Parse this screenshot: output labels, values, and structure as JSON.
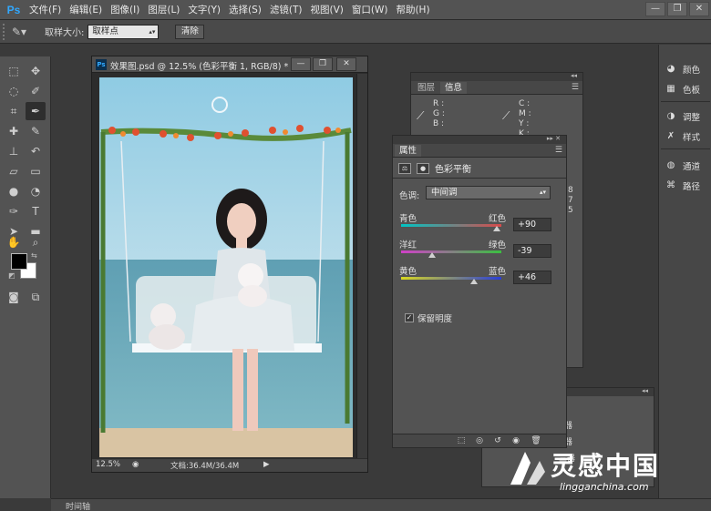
{
  "app": {
    "logo": "Ps"
  },
  "menu": [
    "文件(F)",
    "编辑(E)",
    "图像(I)",
    "图层(L)",
    "文字(Y)",
    "选择(S)",
    "滤镜(T)",
    "视图(V)",
    "窗口(W)",
    "帮助(H)"
  ],
  "window_controls": {
    "minimize": "—",
    "restore": "❐",
    "close": "✕"
  },
  "options": {
    "sample_size_label": "取样大小:",
    "sample_size_value": "取样点",
    "clear_button": "清除"
  },
  "document": {
    "title": "效果图.psd @ 12.5% (色彩平衡 1, RGB/8) *",
    "zoom": "12.5%",
    "doc_size": "文档:36.4M/36.4M"
  },
  "info_panel": {
    "tabs": [
      "图层",
      "信息"
    ],
    "active_tab": "信息",
    "left_channels": [
      "R :",
      "G :",
      "B :"
    ],
    "right_channels": [
      "C :",
      "M :",
      "Y :",
      "K :"
    ]
  },
  "properties_panel": {
    "tab": "属性",
    "title": "色彩平衡",
    "tone_label": "色调:",
    "tone_value": "中间调",
    "sliders": [
      {
        "left": "青色",
        "right": "红色",
        "value": "+90",
        "amount": 90,
        "gradient": "linear-gradient(90deg,#00c4c4,#d84a4a)"
      },
      {
        "left": "洋红",
        "right": "绿色",
        "value": "-39",
        "amount": -39,
        "gradient": "linear-gradient(90deg,#d040c8,#3ac040)"
      },
      {
        "left": "黄色",
        "right": "蓝色",
        "value": "+46",
        "amount": 46,
        "gradient": "linear-gradient(90deg,#d8d820,#2a3ed8)"
      }
    ],
    "preserve_luminosity": "保留明度"
  },
  "behind_panel_numbers": [
    "8",
    "7",
    "5"
  ],
  "layers_panel": {
    "rows": [
      "器",
      "器",
      "三器"
    ]
  },
  "right_dock": [
    "颜色",
    "色板",
    "调整",
    "样式",
    "通道",
    "路径"
  ],
  "timeline": "时间轴",
  "watermark": {
    "main": "灵感中国",
    "sub": "lingganchina.com"
  },
  "colors": {
    "accent": "#31a8ff",
    "panel": "#535353",
    "dark": "#3a3a3a"
  }
}
